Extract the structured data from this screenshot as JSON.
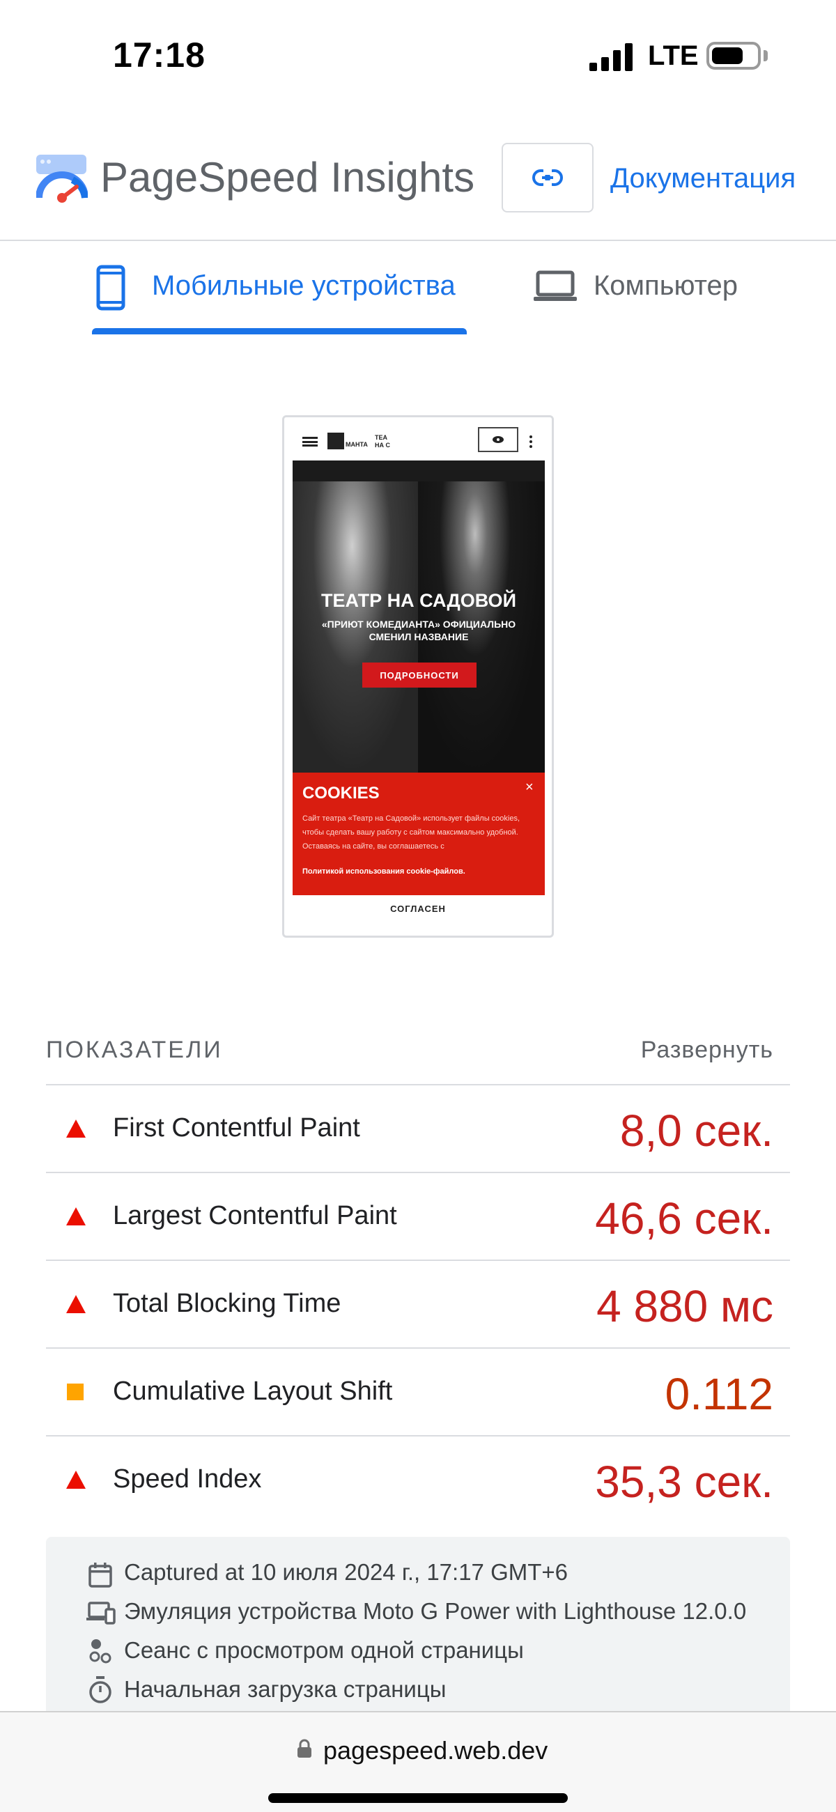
{
  "status_bar": {
    "time": "17:18",
    "network": "LTE"
  },
  "header": {
    "brand": "PageSpeed Insights",
    "docs_link": "Документация"
  },
  "tabs": [
    {
      "label": "Мобильные устройства",
      "active": true
    },
    {
      "label": "Компьютер",
      "active": false
    }
  ],
  "preview": {
    "logo_text": "МАНТА",
    "logo2_line1": "ТЕА",
    "logo2_line2": "НА С",
    "hero_title": "ТЕАТР НА САДОВОЙ",
    "hero_subtitle": "«ПРИЮТ КОМЕДИАНТА» ОФИЦИАЛЬНО СМЕНИЛ НАЗВАНИЕ",
    "hero_button": "ПОДРОБНОСТИ",
    "cookies_title": "COOKIES",
    "cookies_text": "Сайт театра «Театр на Садовой» использует файлы cookies, чтобы сделать вашу работу с сайтом максимально удобной. Оставаясь на сайте, вы соглашаетесь с",
    "cookies_link": "Политикой использования cookie-файлов.",
    "agree_button": "СОГЛАСЕН"
  },
  "metrics": {
    "title": "ПОКАЗАТЕЛИ",
    "expand": "Развернуть",
    "items": [
      {
        "name": "First Contentful Paint",
        "value": "8,0 сек.",
        "status": "fail"
      },
      {
        "name": "Largest Contentful Paint",
        "value": "46,6 сек.",
        "status": "fail"
      },
      {
        "name": "Total Blocking Time",
        "value": "4 880 мс",
        "status": "fail"
      },
      {
        "name": "Cumulative Layout Shift",
        "value": "0.112",
        "status": "average"
      },
      {
        "name": "Speed Index",
        "value": "35,3 сек.",
        "status": "fail"
      }
    ]
  },
  "info": {
    "captured": "Captured at 10 июля 2024 г., 17:17 GMT+6",
    "emulation": "Эмуляция устройства Moto G Power with Lighthouse 12.0.0",
    "session": "Сеанс с просмотром одной страницы",
    "load": "Начальная загрузка страницы"
  },
  "browser": {
    "url": "pagespeed.web.dev"
  },
  "colors": {
    "accent": "#1a73e8",
    "fail": "#c5221f",
    "fail_icon": "#eb0f00",
    "average": "#c33300",
    "average_icon": "#ffa400"
  }
}
